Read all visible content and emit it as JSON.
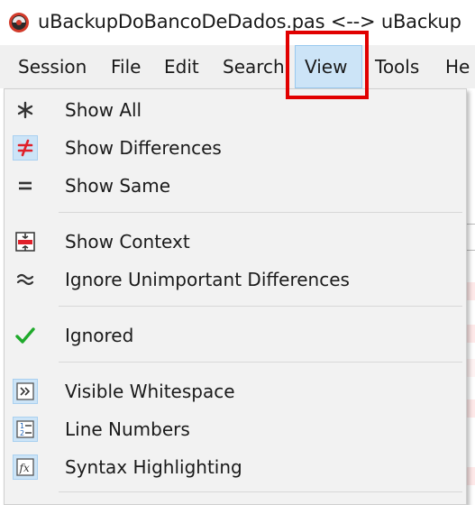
{
  "window": {
    "title": "uBackupDoBancoDeDados.pas <--> uBackup"
  },
  "menubar": {
    "items": [
      {
        "label": "Session"
      },
      {
        "label": "File"
      },
      {
        "label": "Edit"
      },
      {
        "label": "Search"
      },
      {
        "label": "View",
        "active": true
      },
      {
        "label": "Tools"
      },
      {
        "label": "He"
      }
    ]
  },
  "view_menu": {
    "items": [
      {
        "label": "Show All",
        "icon": "asterisk-icon",
        "checked": false
      },
      {
        "label": "Show Differences",
        "icon": "not-equal-icon",
        "checked": true
      },
      {
        "label": "Show Same",
        "icon": "equal-icon",
        "checked": false
      },
      {
        "label": "Show Context",
        "icon": "context-icon",
        "checked": false
      },
      {
        "label": "Ignore Unimportant Differences",
        "icon": "approx-equal-icon",
        "checked": false
      },
      {
        "label": "Ignored",
        "icon": "checkmark-icon",
        "checked": false
      },
      {
        "label": "Visible Whitespace",
        "icon": "whitespace-icon",
        "checked": true
      },
      {
        "label": "Line Numbers",
        "icon": "line-numbers-icon",
        "checked": true
      },
      {
        "label": "Syntax Highlighting",
        "icon": "syntax-fx-icon",
        "checked": true
      }
    ]
  },
  "colors": {
    "highlight_box": "#e10000",
    "menu_active_bg": "#cce4f7",
    "not_equal": "#e0202a",
    "checkmark": "#1faa2b"
  }
}
